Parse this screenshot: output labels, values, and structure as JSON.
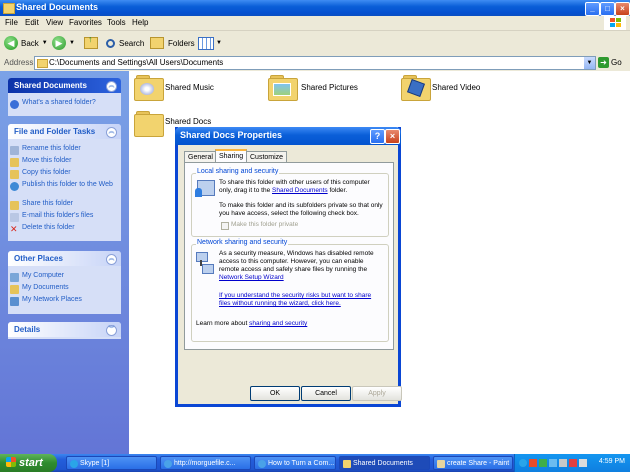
{
  "window": {
    "title": "Shared Documents"
  },
  "menu": [
    "File",
    "Edit",
    "View",
    "Favorites",
    "Tools",
    "Help"
  ],
  "toolbar": {
    "back": "Back",
    "search": "Search",
    "folders": "Folders"
  },
  "address": {
    "label": "Address",
    "path": "C:\\Documents and Settings\\All Users\\Documents",
    "go": "Go"
  },
  "sidebar": {
    "shared": {
      "title": "Shared Documents",
      "item": "What's a shared folder?"
    },
    "tasks": {
      "title": "File and Folder Tasks",
      "items": [
        "Rename this folder",
        "Move this folder",
        "Copy this folder",
        "Publish this folder to the Web",
        "Share this folder",
        "E-mail this folder's files",
        "Delete this folder"
      ]
    },
    "places": {
      "title": "Other Places",
      "items": [
        "My Computer",
        "My Documents",
        "My Network Places"
      ]
    },
    "details": {
      "title": "Details"
    }
  },
  "folders": [
    "Shared Music",
    "Shared Pictures",
    "Shared Video",
    "Shared Docs"
  ],
  "dialog": {
    "title": "Shared Docs Properties",
    "tabs": [
      "General",
      "Sharing",
      "Customize"
    ],
    "local": {
      "label": "Local sharing and security",
      "text1a": "To share this folder with other users of this computer only, drag it to the",
      "link1": "Shared Documents",
      "text1b": "folder.",
      "text2": "To make this folder and its subfolders private so that only you have access, select the following check box.",
      "checkbox": "Make this folder private"
    },
    "network": {
      "label": "Network sharing and security",
      "text1": "As a security measure, Windows has disabled remote access to this computer. However, you can enable remote access and safely share files by running the",
      "link1": "Network Setup Wizard",
      "link2": "If you understand the security risks but want to share files without running the wizard, click here."
    },
    "learn": "Learn more about",
    "learn_link": "sharing and security",
    "buttons": {
      "ok": "OK",
      "cancel": "Cancel",
      "apply": "Apply"
    }
  },
  "taskbar": {
    "start": "start",
    "items": [
      "Skype [1]",
      "http://morguefile.c...",
      "How to Turn a Com...",
      "Shared Documents",
      "create Share - Paint"
    ],
    "clock": "4:59 PM"
  }
}
